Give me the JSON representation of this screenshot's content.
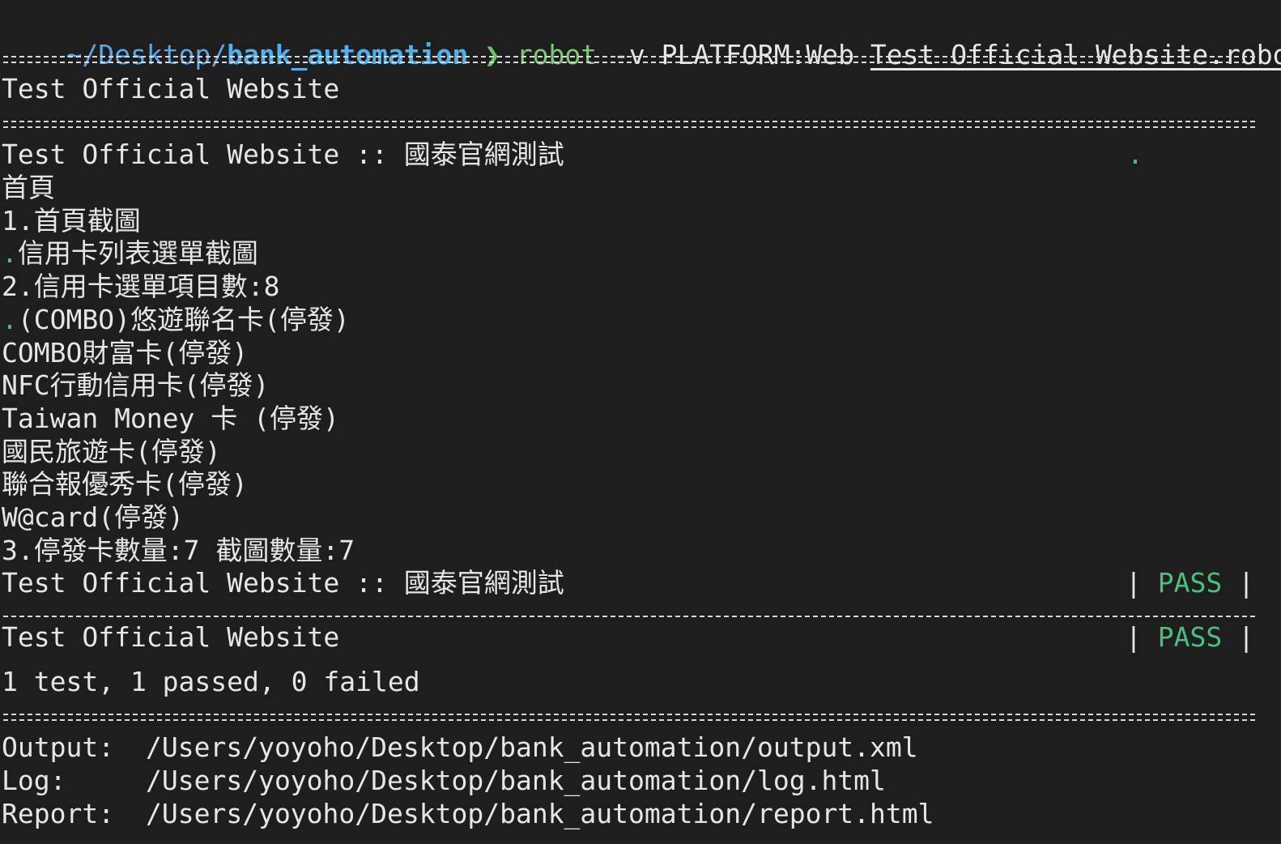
{
  "prompt": {
    "path_prefix": "~/Desktop/",
    "dir": "bank_automation",
    "arrow": "❯",
    "command": "robot",
    "args": " -v PLATFORM:Web ",
    "file": "Test_Official_Website.robot"
  },
  "suite": {
    "title": "Test Official Website",
    "test_title": "Test Official Website :: 國泰官網測試",
    "progress_dot": ".",
    "status_pass": "PASS",
    "pipe": "|"
  },
  "log_lines": [
    {
      "dot": "",
      "text": "首頁"
    },
    {
      "dot": "",
      "text": "1.首頁截圖"
    },
    {
      "dot": ".",
      "text": "信用卡列表選單截圖"
    },
    {
      "dot": "",
      "text": "2.信用卡選單項目數:8"
    },
    {
      "dot": ".",
      "text": "(COMBO)悠遊聯名卡(停發)"
    },
    {
      "dot": "",
      "text": "COMBO財富卡(停發)"
    },
    {
      "dot": "",
      "text": "NFC行動信用卡(停發)"
    },
    {
      "dot": "",
      "text": "Taiwan Money 卡 (停發)"
    },
    {
      "dot": "",
      "text": "國民旅遊卡(停發)"
    },
    {
      "dot": "",
      "text": "聯合報優秀卡(停發)"
    },
    {
      "dot": "",
      "text": "W@card(停發)"
    },
    {
      "dot": "",
      "text": "3.停發卡數量:7 截圖數量:7"
    }
  ],
  "summary": {
    "suite_title": "Test Official Website",
    "counts": "1 test, 1 passed, 0 failed"
  },
  "outputs": {
    "output_label": "Output:",
    "output_path": "/Users/yoyoho/Desktop/bank_automation/output.xml",
    "log_label": "Log:",
    "log_path": "/Users/yoyoho/Desktop/bank_automation/log.html",
    "report_label": "Report:",
    "report_path": "/Users/yoyoho/Desktop/bank_automation/report.html"
  },
  "colors": {
    "background": "#1e1e1e",
    "pass_green": "#4bbf7e",
    "prompt_blue": "#4fb0ef"
  }
}
